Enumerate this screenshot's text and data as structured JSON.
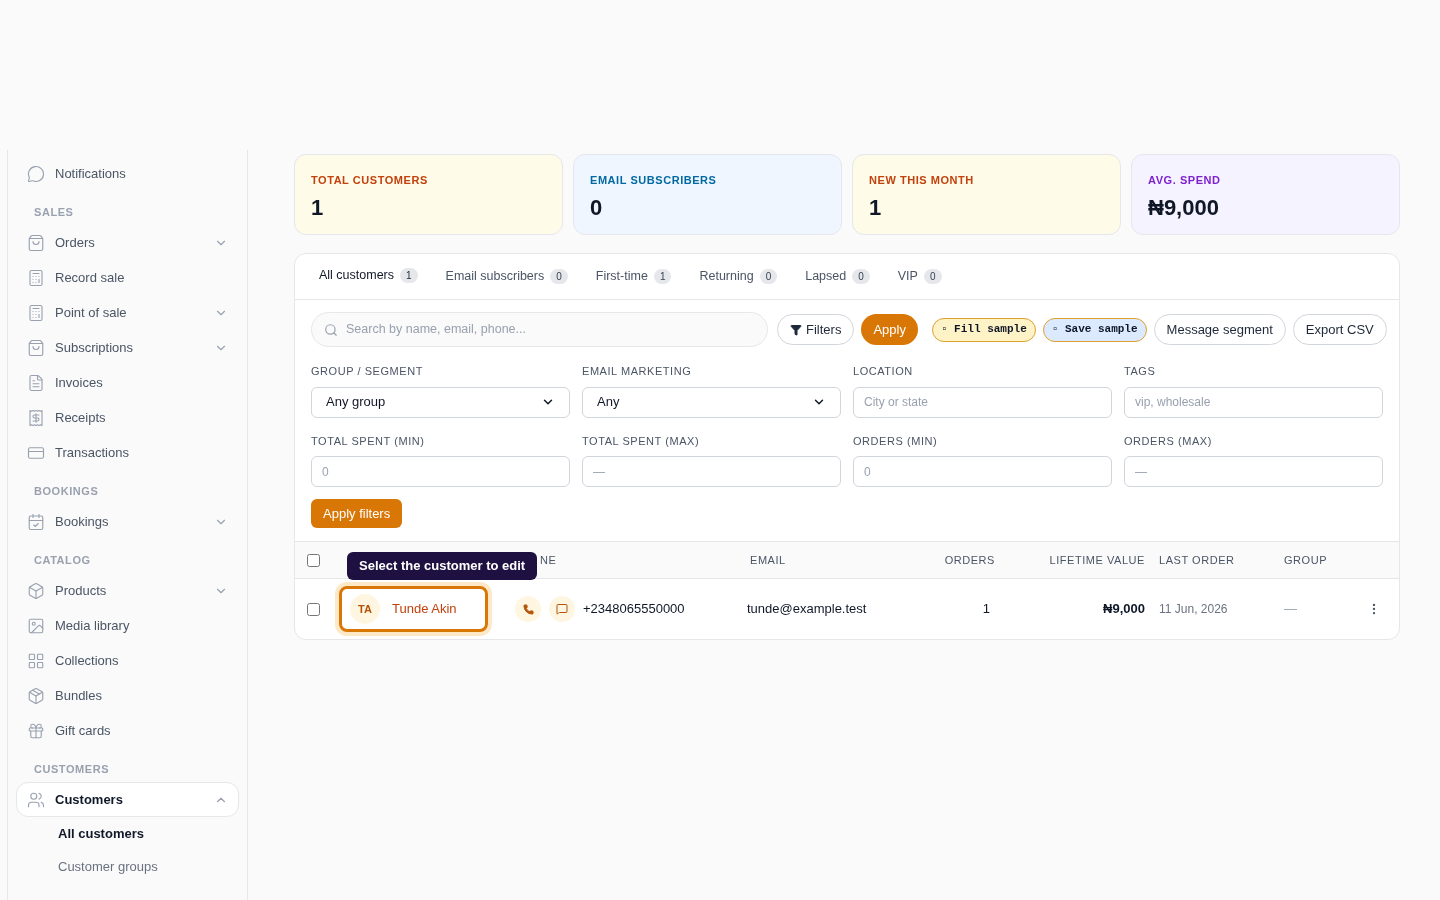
{
  "sidebar": {
    "sections": [
      {
        "items": [
          {
            "label": "Notifications",
            "selected": false
          }
        ]
      },
      {
        "heading": "SALES",
        "items": [
          {
            "label": "Orders",
            "expanded": false,
            "selected": false
          },
          {
            "label": "Record sale",
            "selected": false
          },
          {
            "label": "Point of sale",
            "expanded": false,
            "selected": false
          },
          {
            "label": "Subscriptions",
            "expanded": false,
            "selected": false
          },
          {
            "label": "Invoices",
            "selected": false
          },
          {
            "label": "Receipts",
            "selected": false
          },
          {
            "label": "Transactions",
            "selected": false
          }
        ]
      },
      {
        "heading": "BOOKINGS",
        "items": [
          {
            "label": "Bookings",
            "expanded": false,
            "selected": false
          }
        ]
      },
      {
        "heading": "CATALOG",
        "items": [
          {
            "label": "Products",
            "expanded": false,
            "selected": false
          },
          {
            "label": "Media library",
            "selected": false
          },
          {
            "label": "Collections",
            "selected": false
          },
          {
            "label": "Bundles",
            "selected": false
          },
          {
            "label": "Gift cards",
            "selected": false
          }
        ]
      },
      {
        "heading": "CUSTOMERS",
        "items": [
          {
            "label": "Customers",
            "expanded": true,
            "selected": true,
            "children": [
              {
                "label": "All customers",
                "selected": true
              },
              {
                "label": "Customer groups",
                "selected": false
              }
            ]
          }
        ]
      }
    ]
  },
  "stats": [
    {
      "label": "TOTAL CUSTOMERS",
      "value": "1",
      "color": "#c2410c"
    },
    {
      "label": "EMAIL SUBSCRIBERS",
      "value": "0",
      "color": "#0369a1"
    },
    {
      "label": "NEW THIS MONTH",
      "value": "1",
      "color": "#c2410c"
    },
    {
      "label": "AVG. SPEND",
      "value": "₦9,000",
      "color": "#7e22ce"
    }
  ],
  "tabs": [
    {
      "label": "All customers",
      "count": "1",
      "selected": true
    },
    {
      "label": "Email subscribers",
      "count": "0",
      "selected": false
    },
    {
      "label": "First-time",
      "count": "1",
      "selected": false
    },
    {
      "label": "Returning",
      "count": "0",
      "selected": false
    },
    {
      "label": "Lapsed",
      "count": "0",
      "selected": false
    },
    {
      "label": "VIP",
      "count": "0",
      "selected": false
    }
  ],
  "toolbar": {
    "search": {
      "placeholder": "Search by name, email, phone..."
    },
    "buttons": [
      {
        "kind": "outline-icon",
        "label": "Filters"
      },
      {
        "kind": "primary",
        "label": "Apply"
      },
      {
        "kind": "sample-yellow",
        "label": "▫ Fill sample"
      },
      {
        "kind": "sample-blue",
        "label": "▫ Save sample"
      },
      {
        "kind": "outline",
        "label": "Message segment"
      },
      {
        "kind": "outline",
        "label": "Export CSV"
      }
    ]
  },
  "filters": [
    {
      "label": "GROUP / SEGMENT",
      "kind": "select",
      "value": "Any group"
    },
    {
      "label": "EMAIL MARKETING",
      "kind": "select",
      "value": "Any"
    },
    {
      "label": "LOCATION",
      "kind": "input",
      "placeholder": "City or state"
    },
    {
      "label": "TAGS",
      "kind": "input",
      "placeholder": "vip, wholesale"
    },
    {
      "label": "TOTAL SPENT (MIN)",
      "kind": "input",
      "placeholder": "0"
    },
    {
      "label": "TOTAL SPENT (MAX)",
      "kind": "input",
      "placeholder": "—"
    },
    {
      "label": "ORDERS (MIN)",
      "kind": "input",
      "placeholder": "0"
    },
    {
      "label": "ORDERS (MAX)",
      "kind": "input",
      "placeholder": "—"
    }
  ],
  "apply_filters": "Apply filters",
  "table": {
    "all_checked": false,
    "columns": [
      "NE",
      "EMAIL",
      "ORDERS",
      "LIFETIME VALUE",
      "LAST ORDER",
      "GROUP"
    ],
    "tooltip": "Select the customer to edit",
    "rows": [
      {
        "checked": false,
        "initials": "TA",
        "name": "Tunde Akin",
        "highlighted": true,
        "phone": "+2348065550000",
        "email": "tunde@example.test",
        "orders": "1",
        "lifetime": "₦9,000",
        "last_order": "11 Jun, 2026",
        "group": "—"
      }
    ]
  }
}
